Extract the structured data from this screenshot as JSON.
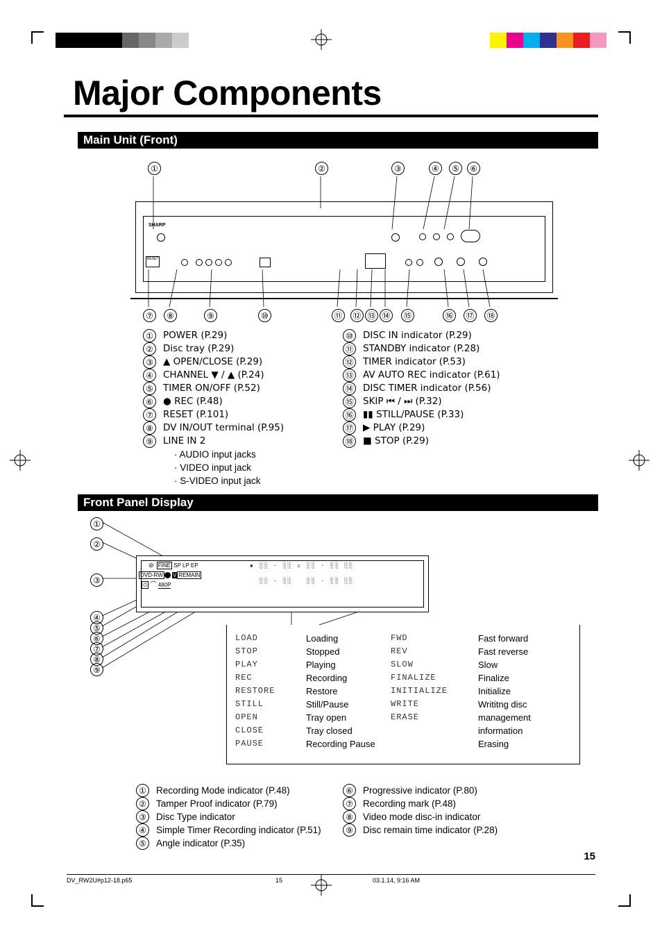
{
  "title": "Major Components",
  "section1": "Main Unit (Front)",
  "section2": "Front Panel Display",
  "legend1": [
    {
      "n": "①",
      "t": "POWER (P.29)"
    },
    {
      "n": "②",
      "t": "Disc tray (P.29)"
    },
    {
      "n": "③",
      "t": "▲ OPEN/CLOSE (P.29)"
    },
    {
      "n": "④",
      "t": "CHANNEL ▼ / ▲ (P.24)"
    },
    {
      "n": "⑤",
      "t": "TIMER ON/OFF (P.52)"
    },
    {
      "n": "⑥",
      "t": "● REC (P.48)"
    },
    {
      "n": "⑦",
      "t": "RESET (P.101)"
    },
    {
      "n": "⑧",
      "t": "DV IN/OUT terminal (P.95)"
    },
    {
      "n": "⑨",
      "t": "LINE IN 2"
    }
  ],
  "legend1_sub": [
    "· AUDIO input jacks",
    "· VIDEO input jack",
    "· S-VIDEO input jack"
  ],
  "legend2": [
    {
      "n": "⑩",
      "t": "DISC IN indicator (P.29)"
    },
    {
      "n": "⑪",
      "t": "STANDBY indicator (P.28)"
    },
    {
      "n": "⑫",
      "t": "TIMER indicator (P.53)"
    },
    {
      "n": "⑬",
      "t": "AV AUTO REC indicator (P.61)"
    },
    {
      "n": "⑭",
      "t": "DISC TIMER indicator (P.56)"
    },
    {
      "n": "⑮",
      "t": "SKIP ⏮ / ⏭ (P.32)"
    },
    {
      "n": "⑯",
      "t": "▮▮ STILL/PAUSE (P.33)"
    },
    {
      "n": "⑰",
      "t": "▶ PLAY (P.29)"
    },
    {
      "n": "⑱",
      "t": "■ STOP (P.29)"
    }
  ],
  "top_callouts_upper": [
    "①",
    "②",
    "③",
    "④",
    "⑤",
    "⑥"
  ],
  "top_callouts_lower": [
    "⑦",
    "⑧",
    "⑨",
    "⑩",
    "⑪",
    "⑫",
    "⑬",
    "⑭",
    "⑮",
    "⑯",
    "⑰",
    "⑱"
  ],
  "fpd_top": [
    "FINE",
    "SP",
    "LP",
    "EP"
  ],
  "fpd_line2_boxes": [
    "DVD-RW",
    "V",
    "REMAIN"
  ],
  "fpd_line3": "480P",
  "fpd_nums": [
    "①",
    "②",
    "③",
    "④",
    "⑤",
    "⑥",
    "⑦",
    "⑧",
    "⑨"
  ],
  "status_left": [
    {
      "s": "LOAD",
      "t": "Loading"
    },
    {
      "s": "STOP",
      "t": "Stopped"
    },
    {
      "s": "PLAY",
      "t": "Playing"
    },
    {
      "s": "REC",
      "t": "Recording"
    },
    {
      "s": "RESTORE",
      "t": "Restore"
    },
    {
      "s": "STILL",
      "t": "Still/Pause"
    },
    {
      "s": "OPEN",
      "t": "Tray open"
    },
    {
      "s": "CLOSE",
      "t": "Tray closed"
    },
    {
      "s": "PAUSE",
      "t": "Recording Pause"
    }
  ],
  "status_right": [
    {
      "s": "FWD",
      "t": "Fast forward"
    },
    {
      "s": "REV",
      "t": "Fast reverse"
    },
    {
      "s": "SLOW",
      "t": "Slow"
    },
    {
      "s": "FINALIZE",
      "t": "Finalize"
    },
    {
      "s": "INITIALIZE",
      "t": "Initialize"
    },
    {
      "s": "WRITE",
      "t": "Writitng disc management information"
    },
    {
      "s": "ERASE",
      "t": "Erasing"
    }
  ],
  "bottom_left": [
    {
      "n": "①",
      "t": "Recording Mode indicator (P.48)"
    },
    {
      "n": "②",
      "t": "Tamper Proof indicator (P.79)"
    },
    {
      "n": "③",
      "t": "Disc Type indicator"
    },
    {
      "n": "④",
      "t": "Simple Timer Recording indicator (P.51)"
    },
    {
      "n": "⑤",
      "t": "Angle indicator (P.35)"
    }
  ],
  "bottom_right": [
    {
      "n": "⑥",
      "t": "Progressive indicator (P.80)"
    },
    {
      "n": "⑦",
      "t": "Recording mark (P.48)"
    },
    {
      "n": "⑧",
      "t": "Video mode disc-in indicator"
    },
    {
      "n": "⑨",
      "t": "Disc remain time indicator (P.28)"
    }
  ],
  "page_num": "15",
  "footer_left": "DV_RW2U#p12-18.p65",
  "footer_mid": "15",
  "footer_right": "03.1.14, 9:16 AM",
  "colors": {
    "c2": "#ed1c24",
    "c3": "#fff200",
    "c4": "#00a651",
    "r1": "#fff200",
    "r2": "#ec008c",
    "r3": "#00aeef",
    "r4": "#2e3192",
    "r5": "#f7941d",
    "r6": "#ed1c24",
    "r7": "#f49ac1"
  }
}
